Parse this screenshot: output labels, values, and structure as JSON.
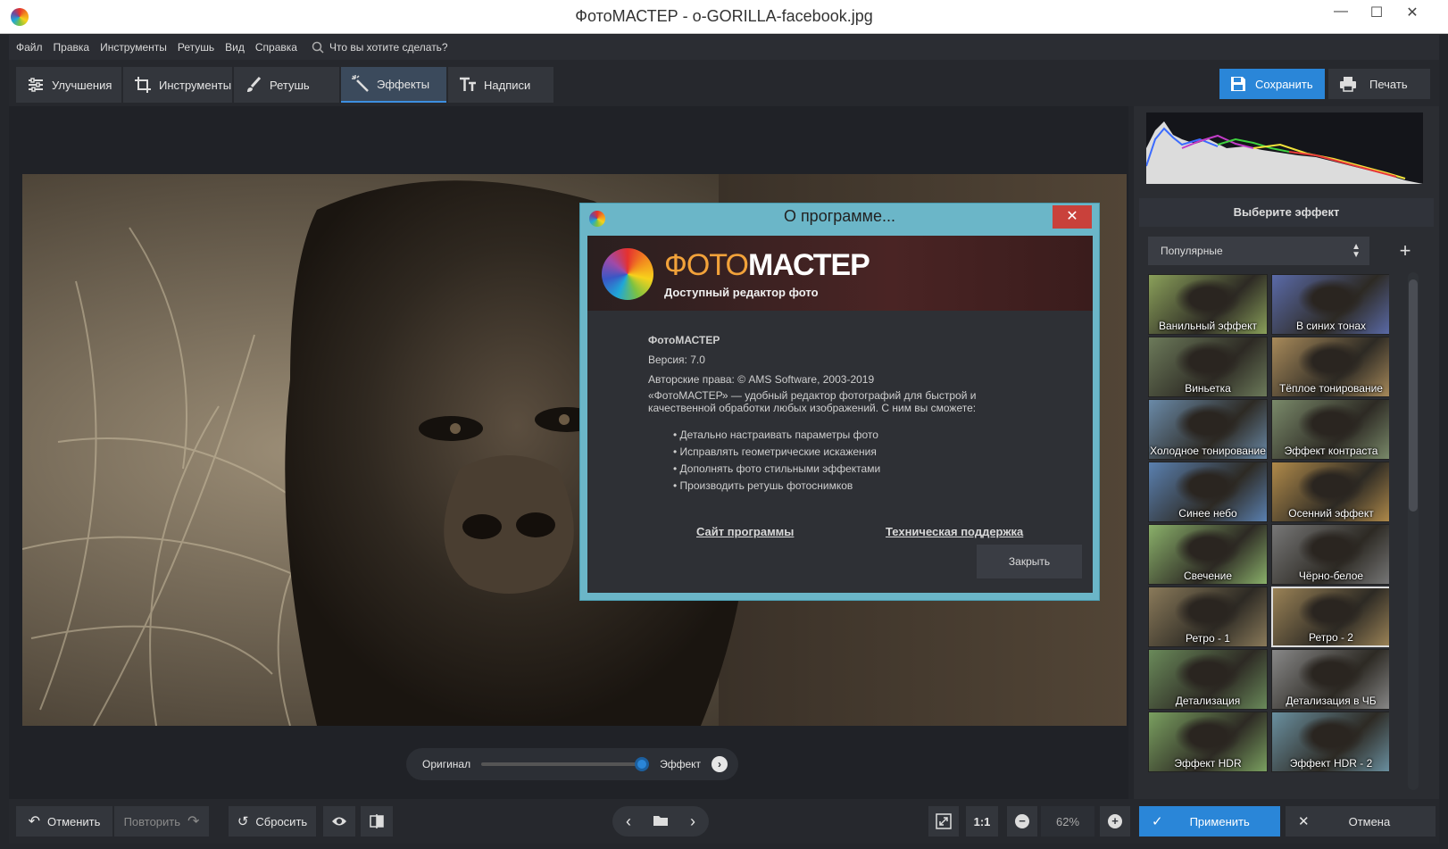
{
  "window": {
    "title": "ФотоМАСТЕР - o-GORILLA-facebook.jpg",
    "minimize": "—",
    "maximize": "☐",
    "close": "✕"
  },
  "menu": {
    "items": [
      "Файл",
      "Правка",
      "Инструменты",
      "Ретушь",
      "Вид",
      "Справка"
    ],
    "search_placeholder": "Что вы хотите сделать?"
  },
  "tabs": [
    {
      "label": "Улучшения",
      "icon": "sliders-icon"
    },
    {
      "label": "Инструменты",
      "icon": "crop-icon"
    },
    {
      "label": "Ретушь",
      "icon": "brush-icon"
    },
    {
      "label": "Эффекты",
      "icon": "magic-wand-icon",
      "active": true
    },
    {
      "label": "Надписи",
      "icon": "text-icon"
    }
  ],
  "actions": {
    "save": "Сохранить",
    "print": "Печать"
  },
  "effects_panel": {
    "header": "Выберите эффект",
    "category": "Популярные",
    "add": "+",
    "effects": [
      "Ванильный эффект",
      "В синих тонах",
      "Виньетка",
      "Тёплое тонирование",
      "Холодное тонирование",
      "Эффект контраста",
      "Синее небо",
      "Осенний эффект",
      "Свечение",
      "Чёрно-белое",
      "Ретро - 1",
      "Ретро - 2",
      "Детализация",
      "Детализация в ЧБ",
      "Эффект HDR",
      "Эффект HDR - 2"
    ],
    "selected": "Ретро - 2"
  },
  "compare": {
    "original": "Оригинал",
    "effect": "Эффект",
    "level": 1.0
  },
  "bottom": {
    "undo": "Отменить",
    "redo": "Повторить",
    "reset": "Сбросить",
    "zoom_fit": "1:1",
    "zoom": "62%",
    "apply": "Применить",
    "cancel": "Отмена"
  },
  "dialog": {
    "title": "О программе...",
    "close_x": "✕",
    "logo_main_a": "ФОТО",
    "logo_main_b": "МАСТЕР",
    "logo_sub": "Доступный редактор фото",
    "app_name": "ФотоМАСТЕР",
    "version": "Версия: 7.0",
    "copyright": "Авторские права: © AMS Software, 2003-2019",
    "desc_1": "«ФотоМАСТЕР» — удобный редактор фотографий для быстрой и",
    "desc_2": "качественной обработки любых изображений. С ним вы сможете:",
    "bullets": [
      "• Детально настраивать параметры фото",
      "• Исправлять геометрические искажения",
      "• Дополнять фото стильными эффектами",
      "• Производить ретушь фотоснимков"
    ],
    "link_site": "Сайт программы",
    "link_support": "Техническая поддержка",
    "close_button": "Закрыть"
  }
}
